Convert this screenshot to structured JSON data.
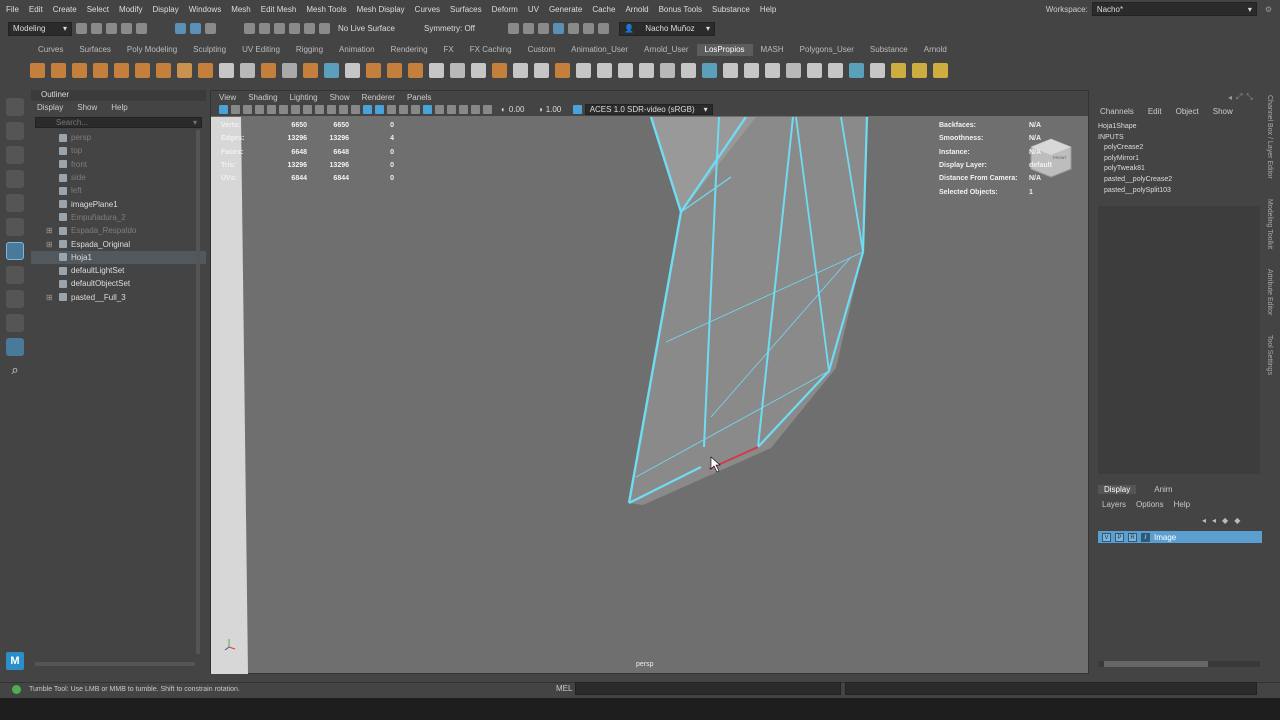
{
  "menubar": {
    "items": [
      "File",
      "Edit",
      "Create",
      "Select",
      "Modify",
      "Display",
      "Windows",
      "Mesh",
      "Edit Mesh",
      "Mesh Tools",
      "Mesh Display",
      "Curves",
      "Surfaces",
      "Deform",
      "UV",
      "Generate",
      "Cache",
      "Arnold",
      "Bonus Tools",
      "Substance",
      "Help"
    ],
    "workspace_label": "Workspace:",
    "workspace_value": "Nacho*"
  },
  "statusline": {
    "mode": "Modeling",
    "live_surface": "No Live Surface",
    "symmetry": "Symmetry: Off",
    "user": "Nacho Muñoz"
  },
  "shelf": {
    "tabs": [
      "Curves",
      "Surfaces",
      "Poly Modeling",
      "Sculpting",
      "UV Editing",
      "Rigging",
      "Animation",
      "Rendering",
      "FX",
      "FX Caching",
      "Custom",
      "Animation_User",
      "Arnold_User",
      "LosPropios",
      "MASH",
      "Polygons_User",
      "Substance",
      "Arnold"
    ],
    "active_tab": "LosPropios"
  },
  "outliner": {
    "title": "Outliner",
    "menu": [
      "Display",
      "Show",
      "Help"
    ],
    "search_placeholder": "Search...",
    "items": [
      {
        "label": "persp",
        "dim": true,
        "expand": false
      },
      {
        "label": "top",
        "dim": true,
        "expand": false
      },
      {
        "label": "front",
        "dim": true,
        "expand": false
      },
      {
        "label": "side",
        "dim": true,
        "expand": false
      },
      {
        "label": "left",
        "dim": true,
        "expand": false
      },
      {
        "label": "imagePlane1",
        "dim": false,
        "expand": false
      },
      {
        "label": "Empuñadura_2",
        "dim": true,
        "expand": false
      },
      {
        "label": "Espada_Respaldo",
        "dim": true,
        "expand": true
      },
      {
        "label": "Espada_Original",
        "dim": false,
        "expand": true
      },
      {
        "label": "Hoja1",
        "dim": false,
        "expand": false,
        "selected": true
      },
      {
        "label": "defaultLightSet",
        "dim": false,
        "expand": false
      },
      {
        "label": "defaultObjectSet",
        "dim": false,
        "expand": false
      },
      {
        "label": "pasted__Full_3",
        "dim": false,
        "expand": true
      }
    ]
  },
  "viewport": {
    "menu": [
      "View",
      "Shading",
      "Lighting",
      "Show",
      "Renderer",
      "Panels"
    ],
    "exposure": "0.00",
    "gamma": "1.00",
    "color_space": "ACES 1.0 SDR-video (sRGB)",
    "camera": "persp",
    "hud_left": [
      {
        "k": "Verts:",
        "a": "6650",
        "b": "6650",
        "c": "0"
      },
      {
        "k": "Edges:",
        "a": "13296",
        "b": "13296",
        "c": "4"
      },
      {
        "k": "Faces:",
        "a": "6648",
        "b": "6648",
        "c": "0"
      },
      {
        "k": "Tris:",
        "a": "13296",
        "b": "13296",
        "c": "0"
      },
      {
        "k": "UVs:",
        "a": "6844",
        "b": "6844",
        "c": "0"
      }
    ],
    "hud_right": [
      {
        "k": "Backfaces:",
        "v": "N/A"
      },
      {
        "k": "Smoothness:",
        "v": "N/A"
      },
      {
        "k": "Instance:",
        "v": "N/A"
      },
      {
        "k": "Display Layer:",
        "v": "default"
      },
      {
        "k": "Distance From Camera:",
        "v": "N/A"
      },
      {
        "k": "Selected Objects:",
        "v": "1"
      }
    ],
    "viewcube_label": "FRONT",
    "wire_color": "#6fdcf2",
    "selected_edge_color": "#d23a4a"
  },
  "channel_box": {
    "menu": [
      "Channels",
      "Edit",
      "Object",
      "Show"
    ],
    "shape": "Hoja1Shape",
    "inputs_label": "INPUTS",
    "inputs": [
      "polyCrease2",
      "polyMirror1",
      "polyTweak81",
      "pasted__polyCrease2",
      "pasted__polySplit103"
    ]
  },
  "layer_editor": {
    "tabs": [
      "Display",
      "Anim"
    ],
    "active_tab": "Display",
    "menu": [
      "Layers",
      "Options",
      "Help"
    ],
    "layer": {
      "v": "V",
      "p": "P",
      "r": "R",
      "name": "Image"
    }
  },
  "side_tabs": [
    "Channel Box / Layer Editor",
    "Modeling Toolkit",
    "Attribute Editor",
    "Tool Settings"
  ],
  "helpline": {
    "text": "Tumble Tool: Use LMB or MMB to tumble. Shift to constrain rotation.",
    "mel_label": "MEL"
  },
  "maya_logo": "M"
}
